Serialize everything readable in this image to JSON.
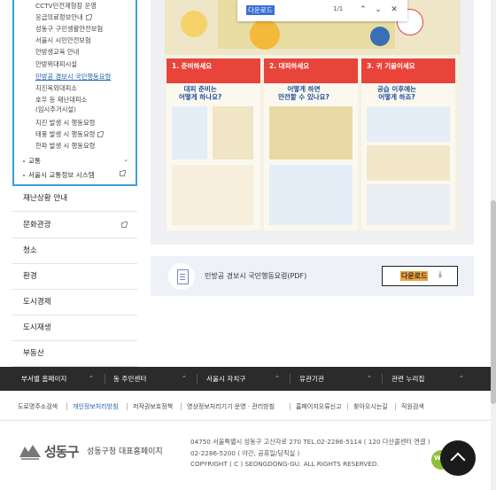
{
  "sidebar": {
    "sub_items": [
      {
        "label": "CCTV민전제형장 운영",
        "ext": false,
        "active": false
      },
      {
        "label": "응급의료정보안내",
        "ext": true,
        "active": false
      },
      {
        "label": "성동구 구민생활안전보험",
        "ext": false,
        "active": false
      },
      {
        "label": "서울시 시민안전보험",
        "ext": false,
        "active": false
      },
      {
        "label": "안방생교육 안내",
        "ext": false,
        "active": false
      },
      {
        "label": "안방위대피시설",
        "ext": false,
        "active": false
      },
      {
        "label": "민방공 경보시 국민행동요령",
        "ext": false,
        "active": true
      },
      {
        "label": "지진옥외대피소",
        "ext": false,
        "active": false
      },
      {
        "label": "호우 등 재난대피소",
        "ext": false,
        "active": false
      },
      {
        "label": "(임시주거시설)",
        "ext": false,
        "active": false
      },
      {
        "label": "지진 발생 시 행동요령",
        "ext": false,
        "active": false
      },
      {
        "label": "태풍 발생 시 행동요령",
        "ext": true,
        "active": false
      },
      {
        "label": "한파 발생 시 행동요령",
        "ext": false,
        "active": false
      }
    ],
    "lvl2": [
      {
        "label": "교통",
        "has_chevron": true
      },
      {
        "label": "서울시 교통정보 시스템",
        "ext": true
      }
    ],
    "menus": [
      {
        "label": "재난상황 안내",
        "ext": false
      },
      {
        "label": "문화관광",
        "ext": true
      },
      {
        "label": "청소",
        "ext": false
      },
      {
        "label": "환경",
        "ext": false
      },
      {
        "label": "도시경제",
        "ext": false
      },
      {
        "label": "도시재생",
        "ext": false
      },
      {
        "label": "부동산",
        "ext": false
      }
    ]
  },
  "findbar": {
    "query": "다운로드",
    "count": "1/1",
    "prev_icon": "chevron-up-icon",
    "next_icon": "chevron-down-icon",
    "close_icon": "close-icon"
  },
  "poster": {
    "columns": [
      {
        "num": "1. 준비하세요",
        "q1": "대피 준비는",
        "q2": "어떻게 하나요?",
        "color": "#e8443a"
      },
      {
        "num": "2. 대피하세요",
        "q1": "어떻게 하면",
        "q2": "안전할 수 있나요?",
        "color": "#e8443a"
      },
      {
        "num": "3. 귀 기울이세요",
        "q1": "공습 이후에는",
        "q2": "어떻게 하죠?",
        "color": "#e8443a"
      }
    ]
  },
  "download": {
    "title": "민방공 경보시 국민행동요령(PDF)",
    "button_label": "다운로드",
    "button_icon": "download-icon"
  },
  "bottom_nav": [
    {
      "label": "부서별 홈페이지"
    },
    {
      "label": "동 주민센터"
    },
    {
      "label": "서울시 자치구"
    },
    {
      "label": "유관기관"
    },
    {
      "label": "관련 누리집"
    }
  ],
  "footer_links": [
    {
      "label": "도로명주소검색",
      "highlight": false
    },
    {
      "label": "개인정보처리방침",
      "highlight": true
    },
    {
      "label": "저작권보호정책",
      "highlight": false
    },
    {
      "label": "영상정보처리기기 운영 · 관리방침",
      "highlight": false
    },
    {
      "label": "홈페이지오류신고",
      "highlight": false
    },
    {
      "label": "찾아오시는길",
      "highlight": false
    },
    {
      "label": "직원검색",
      "highlight": false
    }
  ],
  "footer": {
    "logo_text": "성동구",
    "home_text": "성동구청 대표홈페이지",
    "addr_line1": "04750 서울특별시 성동구 고산자로 270    TEL.02-2286-5114  ( 120 다산콜센터 연결 )",
    "addr_line2": "02-2286-5200  ( 야간, 공휴일/당직실 )",
    "copyright": "COPYRIGHT ( C ) SEONGDONG-GU. ALL RIGHTS RESERVED.",
    "badge_text": "WA"
  },
  "colors": {
    "sidebar_border": "#3ba1d9",
    "active_link": "#1f5fa8",
    "bottom_nav_bg": "#2b2b2b",
    "download_highlight": "#f2a43c",
    "find_highlight": "#3b6fd4"
  }
}
